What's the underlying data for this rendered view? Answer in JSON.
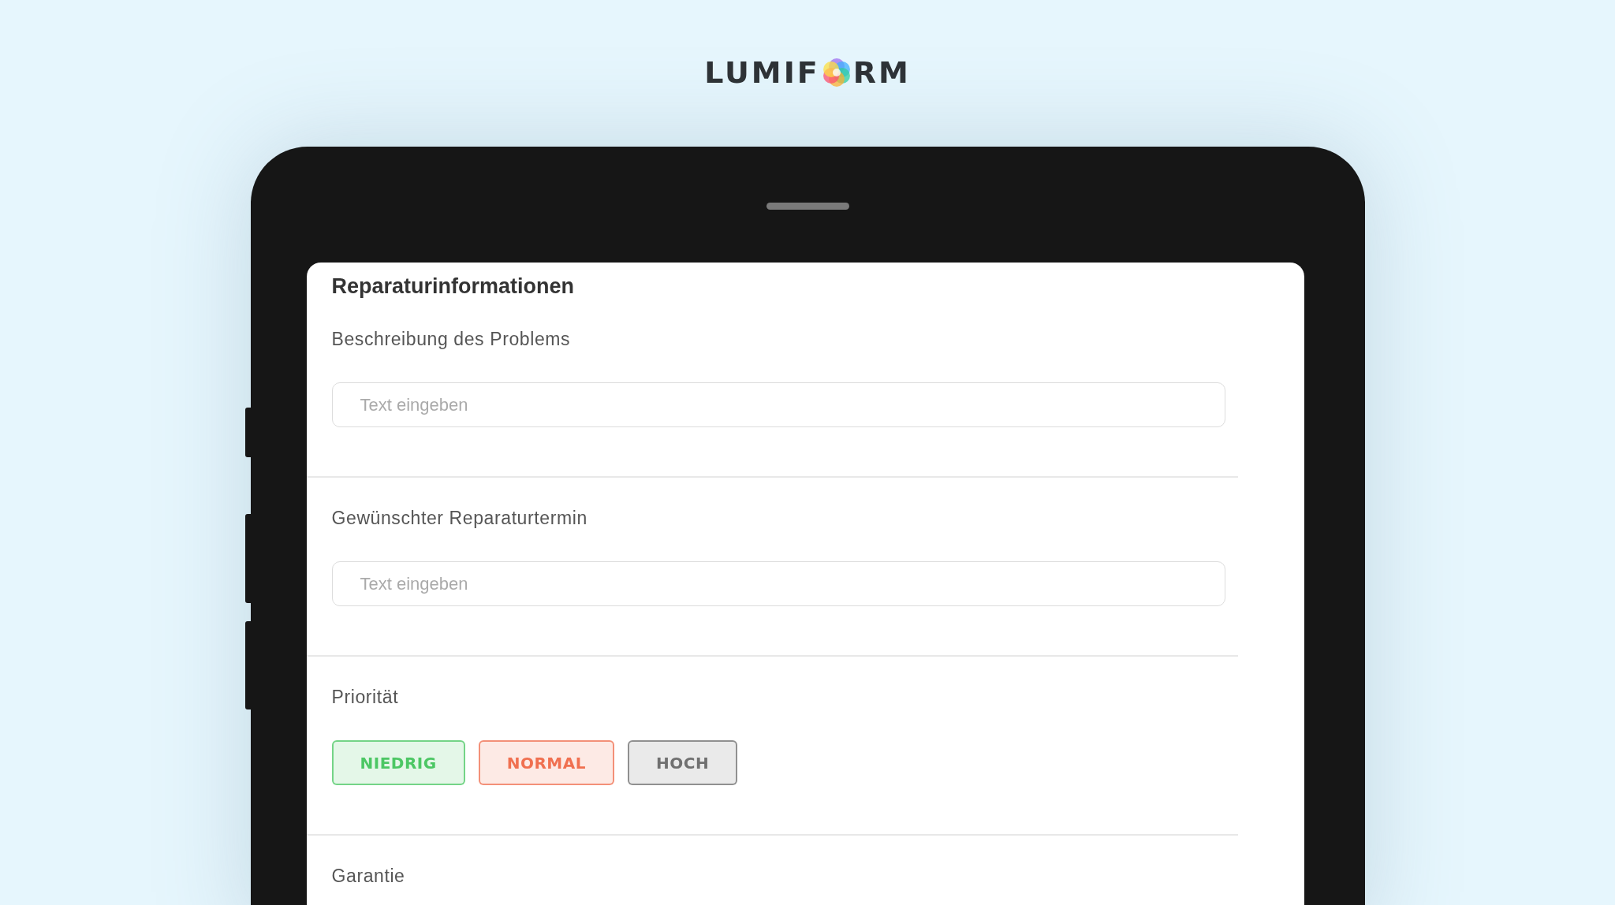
{
  "logo": {
    "before": "LUMIF",
    "after": "RM"
  },
  "form": {
    "title": "Reparaturinformationen",
    "sections": [
      {
        "kind": "input",
        "label": "Beschreibung des Problems",
        "placeholder": "Text eingeben"
      },
      {
        "kind": "input",
        "label": "Gewünschter Reparaturtermin",
        "placeholder": "Text eingeben"
      },
      {
        "kind": "choice",
        "label": "Priorität",
        "options": [
          {
            "label": "NIEDRIG",
            "color": "#4cc764"
          },
          {
            "label": "NORMAL",
            "color": "#f07050"
          },
          {
            "label": "HOCH",
            "color": "#707070"
          }
        ]
      },
      {
        "kind": "label",
        "label": "Garantie"
      }
    ]
  }
}
